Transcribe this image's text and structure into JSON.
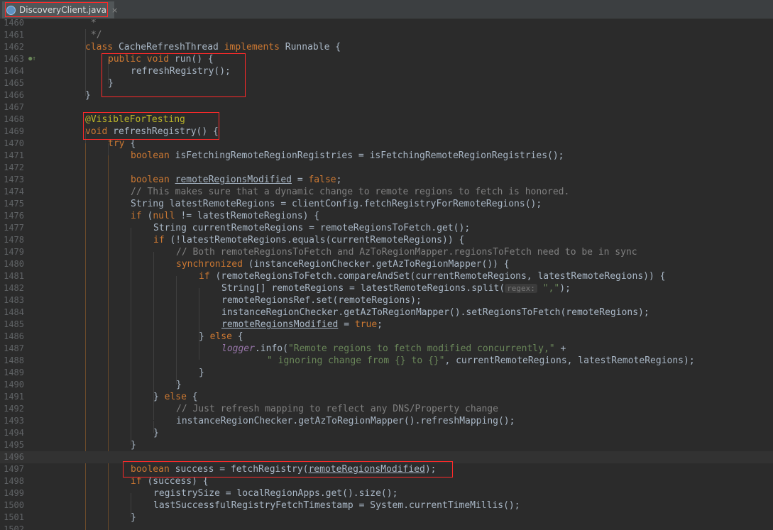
{
  "tab": {
    "file_name": "DiscoveryClient.java",
    "close": "×",
    "icon": "java-class-icon"
  },
  "gutter": {
    "override_marker_icon": "implements-method-icon"
  },
  "colors": {
    "keyword": "#cc7832",
    "string": "#6a8759",
    "comment": "#808080",
    "field": "#9876aa",
    "annotation": "#bbb529",
    "highlight_box": "#ff2a2a"
  },
  "lines": [
    {
      "num": "1460",
      "indent": 1,
      "seg": [
        [
          "cmt",
          " *"
        ]
      ]
    },
    {
      "num": "1461",
      "indent": 1,
      "seg": [
        [
          "cmt",
          " */"
        ]
      ]
    },
    {
      "num": "1462",
      "indent": 1,
      "seg": [
        [
          "kw",
          "class "
        ],
        [
          "call",
          "CacheRefreshThread "
        ],
        [
          "kw",
          "implements "
        ],
        [
          "call",
          "Runnable {"
        ]
      ]
    },
    {
      "num": "1463",
      "indent": 2,
      "marker": true,
      "seg": [
        [
          "kw",
          "public void "
        ],
        [
          "call",
          "run() {"
        ]
      ]
    },
    {
      "num": "1464",
      "indent": 3,
      "seg": [
        [
          "call",
          "refreshRegistry();"
        ]
      ]
    },
    {
      "num": "1465",
      "indent": 2,
      "seg": [
        [
          "call",
          "}"
        ]
      ]
    },
    {
      "num": "1466",
      "indent": 1,
      "seg": [
        [
          "call",
          "}"
        ]
      ]
    },
    {
      "num": "1467",
      "indent": 0,
      "seg": []
    },
    {
      "num": "1468",
      "indent": 1,
      "seg": [
        [
          "ann",
          "@VisibleForTesting"
        ]
      ]
    },
    {
      "num": "1469",
      "indent": 1,
      "seg": [
        [
          "kw",
          "void "
        ],
        [
          "call",
          "refreshRegistry() {"
        ]
      ]
    },
    {
      "num": "1470",
      "indent": 2,
      "seg": [
        [
          "kw",
          "try "
        ],
        [
          "call",
          "{"
        ]
      ]
    },
    {
      "num": "1471",
      "indent": 3,
      "seg": [
        [
          "kw",
          "boolean "
        ],
        [
          "call",
          "isFetchingRemoteRegionRegistries = "
        ],
        [
          "call",
          "isFetchingRemoteRegionRegistries"
        ],
        [
          "call",
          "();"
        ]
      ]
    },
    {
      "num": "1472",
      "indent": 0,
      "seg": []
    },
    {
      "num": "1473",
      "indent": 3,
      "seg": [
        [
          "kw",
          "boolean "
        ],
        [
          "u",
          "remoteRegionsModified"
        ],
        [
          "call",
          " = "
        ],
        [
          "kw",
          "false"
        ],
        [
          "call",
          ";"
        ]
      ]
    },
    {
      "num": "1474",
      "indent": 3,
      "seg": [
        [
          "cmt",
          "// This makes sure that a dynamic change to remote regions to fetch is honored."
        ]
      ]
    },
    {
      "num": "1475",
      "indent": 3,
      "seg": [
        [
          "call",
          "String latestRemoteRegions = "
        ],
        [
          "call",
          "clientConfig"
        ],
        [
          "call",
          "."
        ],
        [
          "call",
          "fetchRegistryForRemoteRegions"
        ],
        [
          "call",
          "();"
        ]
      ]
    },
    {
      "num": "1476",
      "indent": 3,
      "seg": [
        [
          "kw",
          "if "
        ],
        [
          "call",
          "("
        ],
        [
          "kw",
          "null "
        ],
        [
          "call",
          "!= latestRemoteRegions) {"
        ]
      ]
    },
    {
      "num": "1477",
      "indent": 4,
      "seg": [
        [
          "call",
          "String currentRemoteRegions = "
        ],
        [
          "call",
          "remoteRegionsToFetch"
        ],
        [
          "call",
          "."
        ],
        [
          "call",
          "get"
        ],
        [
          "call",
          "();"
        ]
      ]
    },
    {
      "num": "1478",
      "indent": 4,
      "seg": [
        [
          "kw",
          "if "
        ],
        [
          "call",
          "(!latestRemoteRegions."
        ],
        [
          "call",
          "equals"
        ],
        [
          "call",
          "(currentRemoteRegions)) {"
        ]
      ]
    },
    {
      "num": "1479",
      "indent": 5,
      "seg": [
        [
          "cmt",
          "// Both remoteRegionsToFetch and AzToRegionMapper.regionsToFetch need to be in sync"
        ]
      ]
    },
    {
      "num": "1480",
      "indent": 5,
      "seg": [
        [
          "kw",
          "synchronized "
        ],
        [
          "call",
          "("
        ],
        [
          "call",
          "instanceRegionChecker"
        ],
        [
          "call",
          "."
        ],
        [
          "call",
          "getAzToRegionMapper"
        ],
        [
          "call",
          "()) {"
        ]
      ]
    },
    {
      "num": "1481",
      "indent": 6,
      "seg": [
        [
          "kw",
          "if "
        ],
        [
          "call",
          "("
        ],
        [
          "call",
          "remoteRegionsToFetch"
        ],
        [
          "call",
          "."
        ],
        [
          "call",
          "compareAndSet"
        ],
        [
          "call",
          "(currentRemoteRegions, latestRemoteRegions)) {"
        ]
      ]
    },
    {
      "num": "1482",
      "indent": 7,
      "seg": [
        [
          "call",
          "String"
        ],
        [
          "call",
          "[] remoteRegions = latestRemoteRegions."
        ],
        [
          "call",
          "split"
        ],
        [
          "call",
          "("
        ],
        [
          "hint",
          "regex:"
        ],
        [
          "str",
          " \",\""
        ],
        [
          "call",
          ");"
        ]
      ]
    },
    {
      "num": "1483",
      "indent": 7,
      "seg": [
        [
          "call",
          "remoteRegionsRef"
        ],
        [
          "call",
          "."
        ],
        [
          "call",
          "set"
        ],
        [
          "call",
          "(remoteRegions);"
        ]
      ]
    },
    {
      "num": "1484",
      "indent": 7,
      "seg": [
        [
          "call",
          "instanceRegionChecker"
        ],
        [
          "call",
          "."
        ],
        [
          "call",
          "getAzToRegionMapper"
        ],
        [
          "call",
          "()."
        ],
        [
          "call",
          "setRegionsToFetch"
        ],
        [
          "call",
          "(remoteRegions);"
        ]
      ]
    },
    {
      "num": "1485",
      "indent": 7,
      "seg": [
        [
          "u",
          "remoteRegionsModified"
        ],
        [
          "call",
          " = "
        ],
        [
          "kw",
          "true"
        ],
        [
          "call",
          ";"
        ]
      ]
    },
    {
      "num": "1486",
      "indent": 6,
      "seg": [
        [
          "call",
          "} "
        ],
        [
          "kw",
          "else "
        ],
        [
          "call",
          "{"
        ]
      ]
    },
    {
      "num": "1487",
      "indent": 7,
      "seg": [
        [
          "logger",
          "logger"
        ],
        [
          "call",
          "."
        ],
        [
          "call",
          "info"
        ],
        [
          "call",
          "("
        ],
        [
          "str",
          "\"Remote regions to fetch modified concurrently,\""
        ],
        [
          "call",
          " +"
        ]
      ]
    },
    {
      "num": "1488",
      "indent": 9,
      "seg": [
        [
          "str",
          "\" ignoring change from {} to {}\""
        ],
        [
          "call",
          ", currentRemoteRegions, latestRemoteRegions);"
        ]
      ]
    },
    {
      "num": "1489",
      "indent": 6,
      "seg": [
        [
          "call",
          "}"
        ]
      ]
    },
    {
      "num": "1490",
      "indent": 5,
      "seg": [
        [
          "call",
          "}"
        ]
      ]
    },
    {
      "num": "1491",
      "indent": 4,
      "seg": [
        [
          "call",
          "} "
        ],
        [
          "kw",
          "else "
        ],
        [
          "call",
          "{"
        ]
      ]
    },
    {
      "num": "1492",
      "indent": 5,
      "seg": [
        [
          "cmt",
          "// Just refresh mapping to reflect any DNS/Property change"
        ]
      ]
    },
    {
      "num": "1493",
      "indent": 5,
      "seg": [
        [
          "call",
          "instanceRegionChecker"
        ],
        [
          "call",
          "."
        ],
        [
          "call",
          "getAzToRegionMapper"
        ],
        [
          "call",
          "()."
        ],
        [
          "call",
          "refreshMapping"
        ],
        [
          "call",
          "();"
        ]
      ]
    },
    {
      "num": "1494",
      "indent": 4,
      "seg": [
        [
          "call",
          "}"
        ]
      ]
    },
    {
      "num": "1495",
      "indent": 3,
      "seg": [
        [
          "call",
          "}"
        ]
      ]
    },
    {
      "num": "1496",
      "indent": 0,
      "highlight": true,
      "seg": []
    },
    {
      "num": "1497",
      "indent": 3,
      "seg": [
        [
          "kw",
          "boolean "
        ],
        [
          "call",
          "success = "
        ],
        [
          "call",
          "fetchRegistry"
        ],
        [
          "call",
          "("
        ],
        [
          "u",
          "remoteRegionsModified"
        ],
        [
          "call",
          ");"
        ]
      ]
    },
    {
      "num": "1498",
      "indent": 3,
      "seg": [
        [
          "kw",
          "if "
        ],
        [
          "call",
          "(success) {"
        ]
      ]
    },
    {
      "num": "1499",
      "indent": 4,
      "seg": [
        [
          "call",
          "registrySize"
        ],
        [
          "call",
          " = "
        ],
        [
          "call",
          "localRegionApps"
        ],
        [
          "call",
          "."
        ],
        [
          "call",
          "get"
        ],
        [
          "call",
          "()."
        ],
        [
          "call",
          "size"
        ],
        [
          "call",
          "();"
        ]
      ]
    },
    {
      "num": "1500",
      "indent": 4,
      "seg": [
        [
          "call",
          "lastSuccessfulRegistryFetchTimestamp"
        ],
        [
          "call",
          " = System."
        ],
        [
          "call",
          "currentTimeMillis"
        ],
        [
          "call",
          "();"
        ]
      ]
    },
    {
      "num": "1501",
      "indent": 3,
      "seg": [
        [
          "call",
          "}"
        ]
      ]
    },
    {
      "num": "1502",
      "indent": 0,
      "seg": []
    }
  ]
}
